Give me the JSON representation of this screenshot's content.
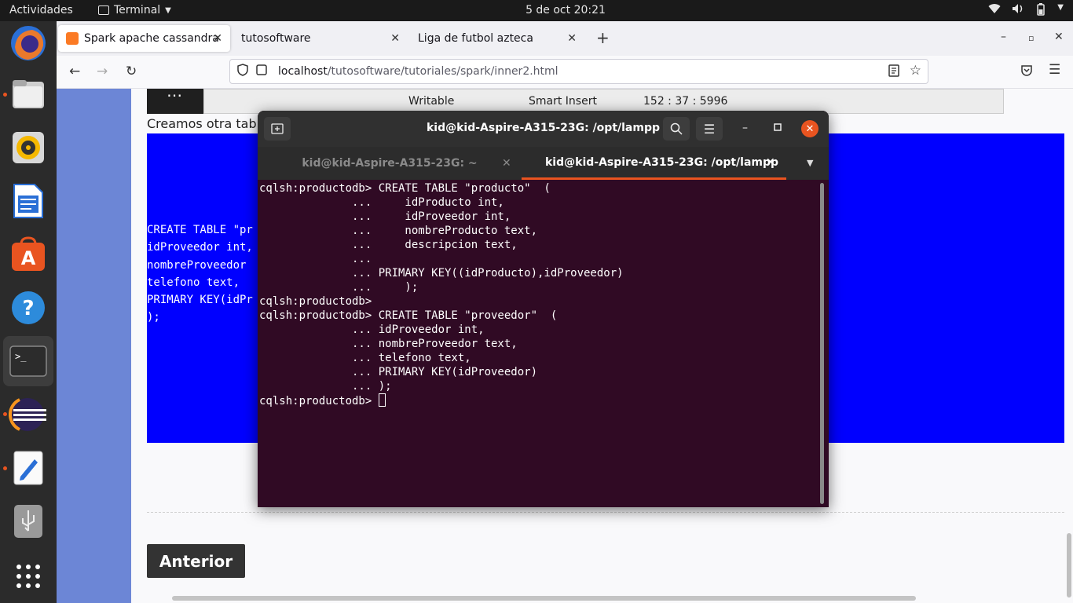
{
  "topbar": {
    "activities": "Actividades",
    "app_name": "Terminal",
    "clock": "5 de oct  20:21"
  },
  "browser": {
    "tabs": [
      {
        "label": "Spark apache cassandra"
      },
      {
        "label": "tutosoftware"
      },
      {
        "label": "Liga de futbol azteca"
      }
    ],
    "url_host": "localhost",
    "url_path": "/tutosoftware/tutoriales/spark/inner2.html"
  },
  "page": {
    "status_strip": {
      "writable": "Writable",
      "smart_insert": "Smart Insert",
      "position": "152 : 37 : 5996"
    },
    "heading": "Creamos otra tab",
    "blue_code": "CREATE TABLE \"pr\nidProveedor int,\nnombreProveedor \ntelefono text,\nPRIMARY KEY(idPr\n);",
    "anterior": "Anterior"
  },
  "terminal": {
    "title": "kid@kid-Aspire-A315-23G: /opt/lampp",
    "tabs": [
      {
        "label": "kid@kid-Aspire-A315-23G: ~"
      },
      {
        "label": "kid@kid-Aspire-A315-23G: /opt/lampp"
      }
    ],
    "output": "cqlsh:productodb> CREATE TABLE \"producto\"  (\n              ...     idProducto int,\n              ...     idProveedor int,\n              ...     nombreProducto text,\n              ...     descripcion text,\n              ...\n              ... PRIMARY KEY((idProducto),idProveedor)\n              ...     );\ncqlsh:productodb>\ncqlsh:productodb> CREATE TABLE \"proveedor\"  (\n              ... idProveedor int,\n              ... nombreProveedor text,\n              ... telefono text,\n              ... PRIMARY KEY(idProveedor)\n              ... );",
    "prompt": "cqlsh:productodb> "
  },
  "colors": {
    "terminal_bg": "#300a24",
    "accent": "#e95420",
    "page_blue": "#0000ff"
  }
}
